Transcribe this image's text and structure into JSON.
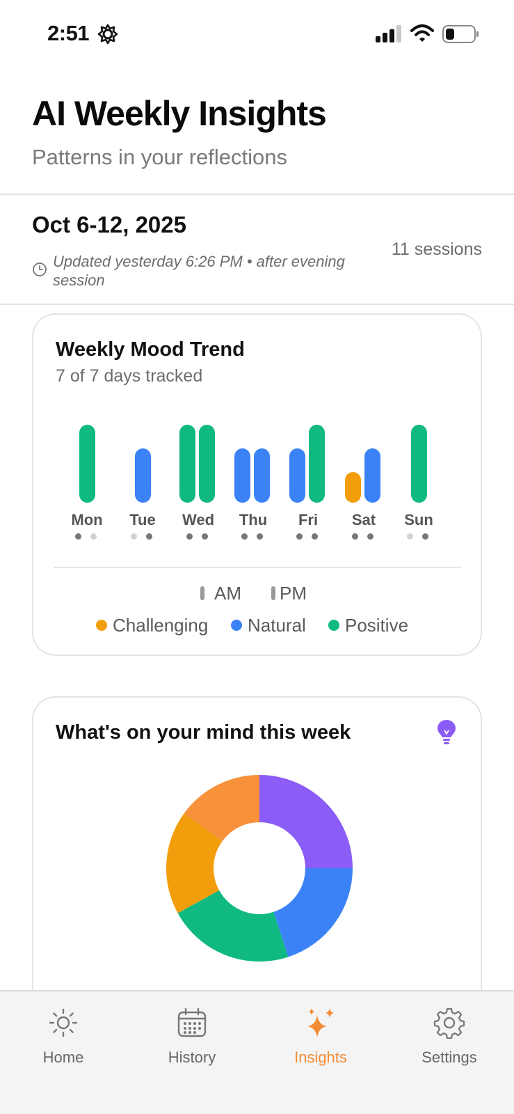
{
  "status_bar": {
    "time": "2:51"
  },
  "header": {
    "title": "AI Weekly Insights",
    "subtitle": "Patterns in your reflections"
  },
  "week": {
    "range": "Oct 6-12, 2025",
    "updated": "Updated yesterday 6:26 PM • after evening session",
    "sessions": "11 sessions"
  },
  "colors": {
    "challenging": "#f29e0c",
    "natural": "#3b82f6",
    "positive": "#10b981",
    "accent": "#f28b35",
    "purple": "#8b5cf6",
    "orange_light": "#f7913a"
  },
  "mood_card": {
    "title": "Weekly Mood Trend",
    "subtitle": "7 of 7 days tracked",
    "days": [
      {
        "label": "Mon",
        "am": null,
        "pm": "positive",
        "am_dot": "filled",
        "pm_dot": "empty"
      },
      {
        "label": "Tue",
        "am": null,
        "pm": "natural",
        "am_dot": "empty",
        "pm_dot": "filled"
      },
      {
        "label": "Wed",
        "am": "positive",
        "pm": "positive",
        "am_dot": "filled",
        "pm_dot": "filled"
      },
      {
        "label": "Thu",
        "am": "natural",
        "pm": "natural",
        "am_dot": "filled",
        "pm_dot": "filled"
      },
      {
        "label": "Fri",
        "am": "natural",
        "pm": "positive",
        "am_dot": "filled",
        "pm_dot": "filled"
      },
      {
        "label": "Sat",
        "am": "challenging",
        "pm": "natural",
        "am_dot": "filled",
        "pm_dot": "filled"
      },
      {
        "label": "Sun",
        "am": null,
        "pm": "positive",
        "am_dot": "empty",
        "pm_dot": "filled"
      }
    ],
    "legend": {
      "am": "AM",
      "pm": "PM",
      "challenging": "Challenging",
      "natural": "Natural",
      "positive": "Positive"
    }
  },
  "mind_card": {
    "title": "What's on your mind this week",
    "slices": [
      {
        "color": "purple",
        "value": 25
      },
      {
        "color": "natural",
        "value": 20
      },
      {
        "color": "positive",
        "value": 22
      },
      {
        "color": "challenging",
        "value": 18
      },
      {
        "color": "orange_light",
        "value": 15
      }
    ]
  },
  "tabs": [
    {
      "label": "Home",
      "icon": "sun-icon"
    },
    {
      "label": "History",
      "icon": "calendar-icon"
    },
    {
      "label": "Insights",
      "icon": "sparkles-icon"
    },
    {
      "label": "Settings",
      "icon": "gear-icon"
    }
  ]
}
